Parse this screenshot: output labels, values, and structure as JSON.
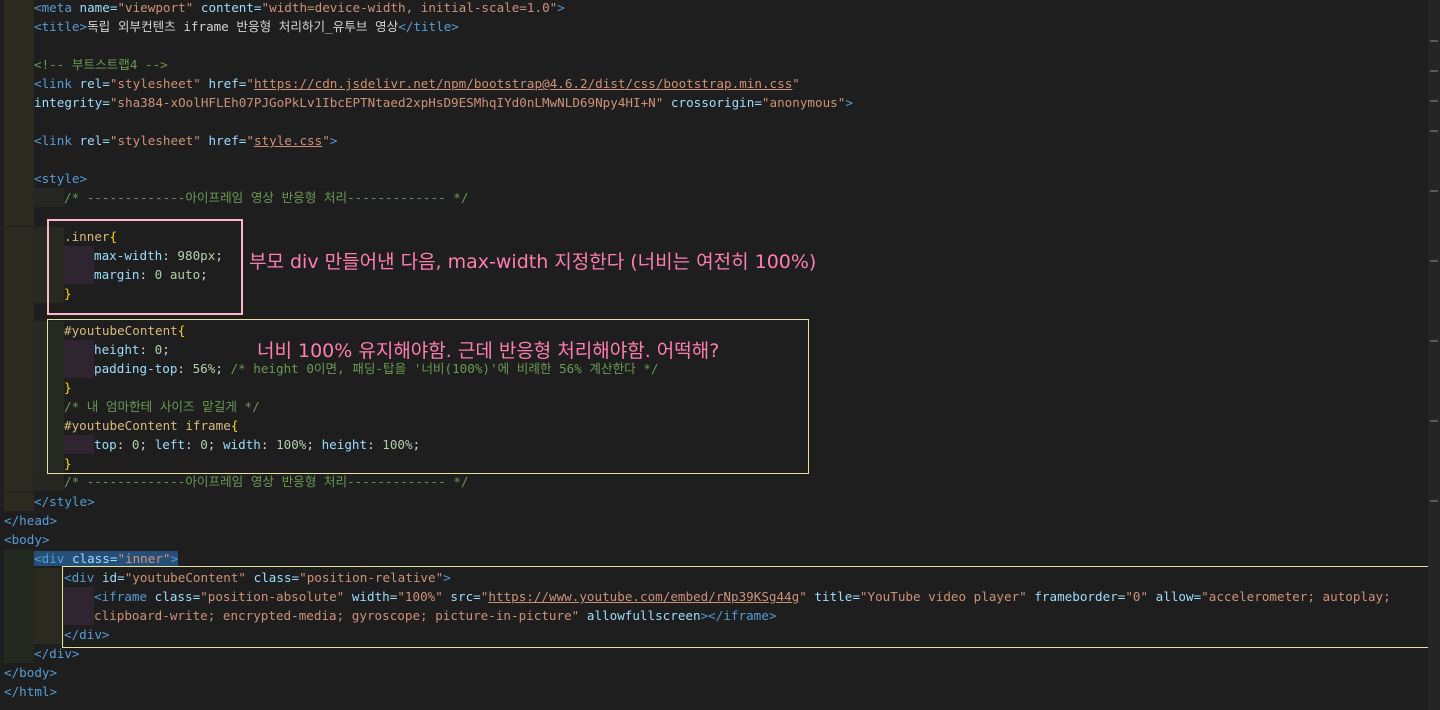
{
  "lines": {
    "l1": {
      "t1": "<meta",
      "a1": "name=",
      "s1": "\"viewport\"",
      "a2": "content=",
      "s2": "\"width=device-width, initial-scale=1.0\"",
      "t2": ">"
    },
    "l2": {
      "t1": "<title>",
      "txt": "독립 외부컨텐츠 iframe 반응형 처리하기_유투브 영상",
      "t2": "</title>"
    },
    "l4": {
      "c": "<!-- 부트스트랩4 -->"
    },
    "l5": {
      "t1": "<link",
      "a1": "rel=",
      "s1": "\"stylesheet\"",
      "a2": "href=",
      "q1": "\"",
      "url": "https://cdn.jsdelivr.net/npm/bootstrap@4.6.2/dist/css/bootstrap.min.css",
      "q2": "\""
    },
    "l6": {
      "a1": "integrity=",
      "s1": "\"sha384-xOolHFLEh07PJGoPkLv1IbcEPTNtaed2xpHsD9ESMhqIYd0nLMwNLD69Npy4HI+N\"",
      "a2": "crossorigin=",
      "s2": "\"anonymous\"",
      "t2": ">"
    },
    "l8": {
      "t1": "<link",
      "a1": "rel=",
      "s1": "\"stylesheet\"",
      "a2": "href=",
      "q1": "\"",
      "url": "style.css",
      "q2": "\"",
      "t2": ">"
    },
    "l10": {
      "t1": "<style>"
    },
    "l11": {
      "c": "/* -------------아이프레임 영상 반응형 처리------------- */"
    },
    "l13": {
      "sel": ".inner",
      "br": "{"
    },
    "l14": {
      "prop": "max-width",
      "sep": ": ",
      "val": "980px",
      ";": ";"
    },
    "l15": {
      "prop": "margin",
      "sep": ": ",
      "val": "0 auto",
      ";": ";"
    },
    "l16": {
      "br": "}"
    },
    "l18": {
      "sel": "#youtubeContent",
      "br": "{"
    },
    "l19": {
      "prop": "height",
      "sep": ": ",
      "val": "0",
      ";": ";"
    },
    "l20": {
      "prop": "padding-top",
      "sep": ": ",
      "val": "56%",
      ";": ";",
      "c": " /* height 0이면, 패딩-탑을 '너비(100%)'에 비례한 56% 계산한다 */"
    },
    "l21": {
      "br": "}"
    },
    "l22": {
      "c": "/* 내 엄마한테 사이즈 맡길게 */"
    },
    "l23": {
      "sel": "#youtubeContent iframe",
      "br": "{"
    },
    "l24": {
      "p1": "top",
      "v1": "0",
      "p2": "left",
      "v2": "0",
      "p3": "width",
      "v3": "100%",
      "p4": "height",
      "v4": "100%"
    },
    "l25": {
      "br": "}"
    },
    "l26": {
      "c": "/* -------------아이프레임 영상 반응형 처리------------- */"
    },
    "l27": {
      "t1": "</style>"
    },
    "l28": {
      "t1": "</head>"
    },
    "l29": {
      "t1": "<body>"
    },
    "l30": {
      "t1": "<div",
      "a1": "class=",
      "s1": "\"inner\"",
      "t2": ">"
    },
    "l31": {
      "t1": "<div",
      "a1": "id=",
      "s1": "\"youtubeContent\"",
      "a2": "class=",
      "s2": "\"position-relative\"",
      "t2": ">"
    },
    "l32": {
      "t1": "<iframe",
      "a1": "class=",
      "s1": "\"position-absolute\"",
      "a2": "width=",
      "s2": "\"100%\"",
      "a3": "src=",
      "q1": "\"",
      "url": "https://www.youtube.com/embed/rNp39KSg44g",
      "q2": "\"",
      "a4": "title=",
      "s4": "\"YouTube video player\"",
      "a5": "frameborder=",
      "s5": "\"0\"",
      "a6": "allow=",
      "s6": "\"accelerometer; autoplay;"
    },
    "l33": {
      "s1": "clipboard-write; encrypted-media; gyroscope; picture-in-picture\"",
      "a1": "allowfullscreen",
      "t1": "></iframe>"
    },
    "l34": {
      "t1": "</div>"
    },
    "l35": {
      "t1": "</div>"
    },
    "l36": {
      "t1": "</body>"
    },
    "l37": {
      "t1": "</html>"
    }
  },
  "annotations": {
    "inner": "부모 div 만들어낸 다음, max-width 지정한다 (너비는 여전히 100%)",
    "youtube": "너비 100% 유지해야함. 근데 반응형 처리해야함. 어떡해?"
  },
  "colors": {
    "pink_box": "#ffb6c8",
    "yellow_box": "#e8e0a0",
    "background": "#1e1e1e"
  }
}
